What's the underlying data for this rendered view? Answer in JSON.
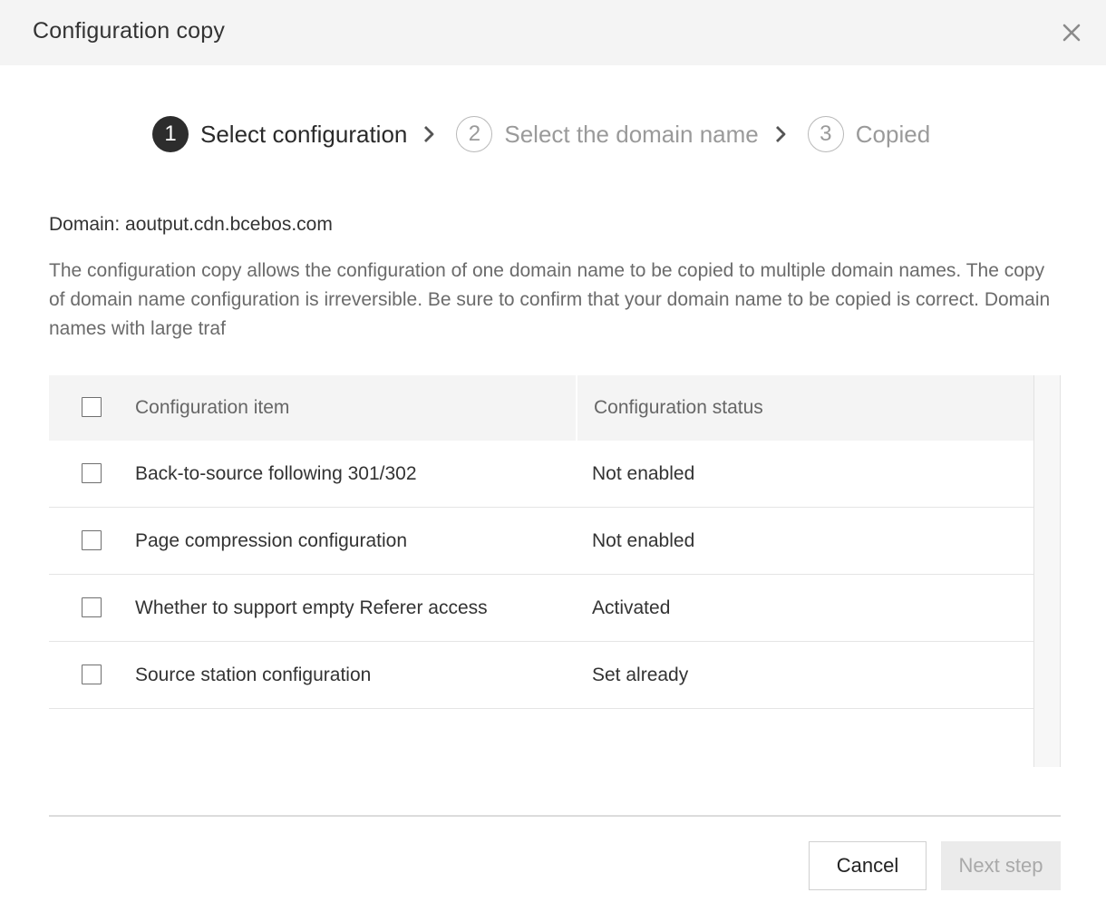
{
  "dialog": {
    "title": "Configuration copy",
    "close_icon": "close-icon"
  },
  "steps": [
    {
      "number": "1",
      "label": "Select configuration",
      "state": "active"
    },
    {
      "number": "2",
      "label": "Select the domain name",
      "state": "inactive"
    },
    {
      "number": "3",
      "label": "Copied",
      "state": "inactive"
    }
  ],
  "domain": {
    "label": "Domain:",
    "value": "aoutput.cdn.bcebos.com",
    "full": "Domain: aoutput.cdn.bcebos.com"
  },
  "description": "The configuration copy allows the configuration of one domain name to be copied to multiple domain names. The copy of domain name configuration is irreversible. Be sure to confirm that your domain name to be copied is correct. Domain names with large traf",
  "table": {
    "headers": {
      "item": "Configuration item",
      "status": "Configuration status"
    },
    "rows": [
      {
        "item": "Back-to-source following 301/302",
        "status": "Not enabled",
        "checked": false
      },
      {
        "item": "Page compression configuration",
        "status": "Not enabled",
        "checked": false
      },
      {
        "item": "Whether to support empty Referer access",
        "status": "Activated",
        "checked": false
      },
      {
        "item": "Source station configuration",
        "status": "Set already",
        "checked": false
      }
    ]
  },
  "footer": {
    "cancel_label": "Cancel",
    "next_label": "Next step"
  },
  "colors": {
    "active_step": "#2d2d2d",
    "header_bg": "#f4f4f4",
    "disabled_button_bg": "#ebebeb",
    "disabled_button_text": "#a9a9a9"
  }
}
